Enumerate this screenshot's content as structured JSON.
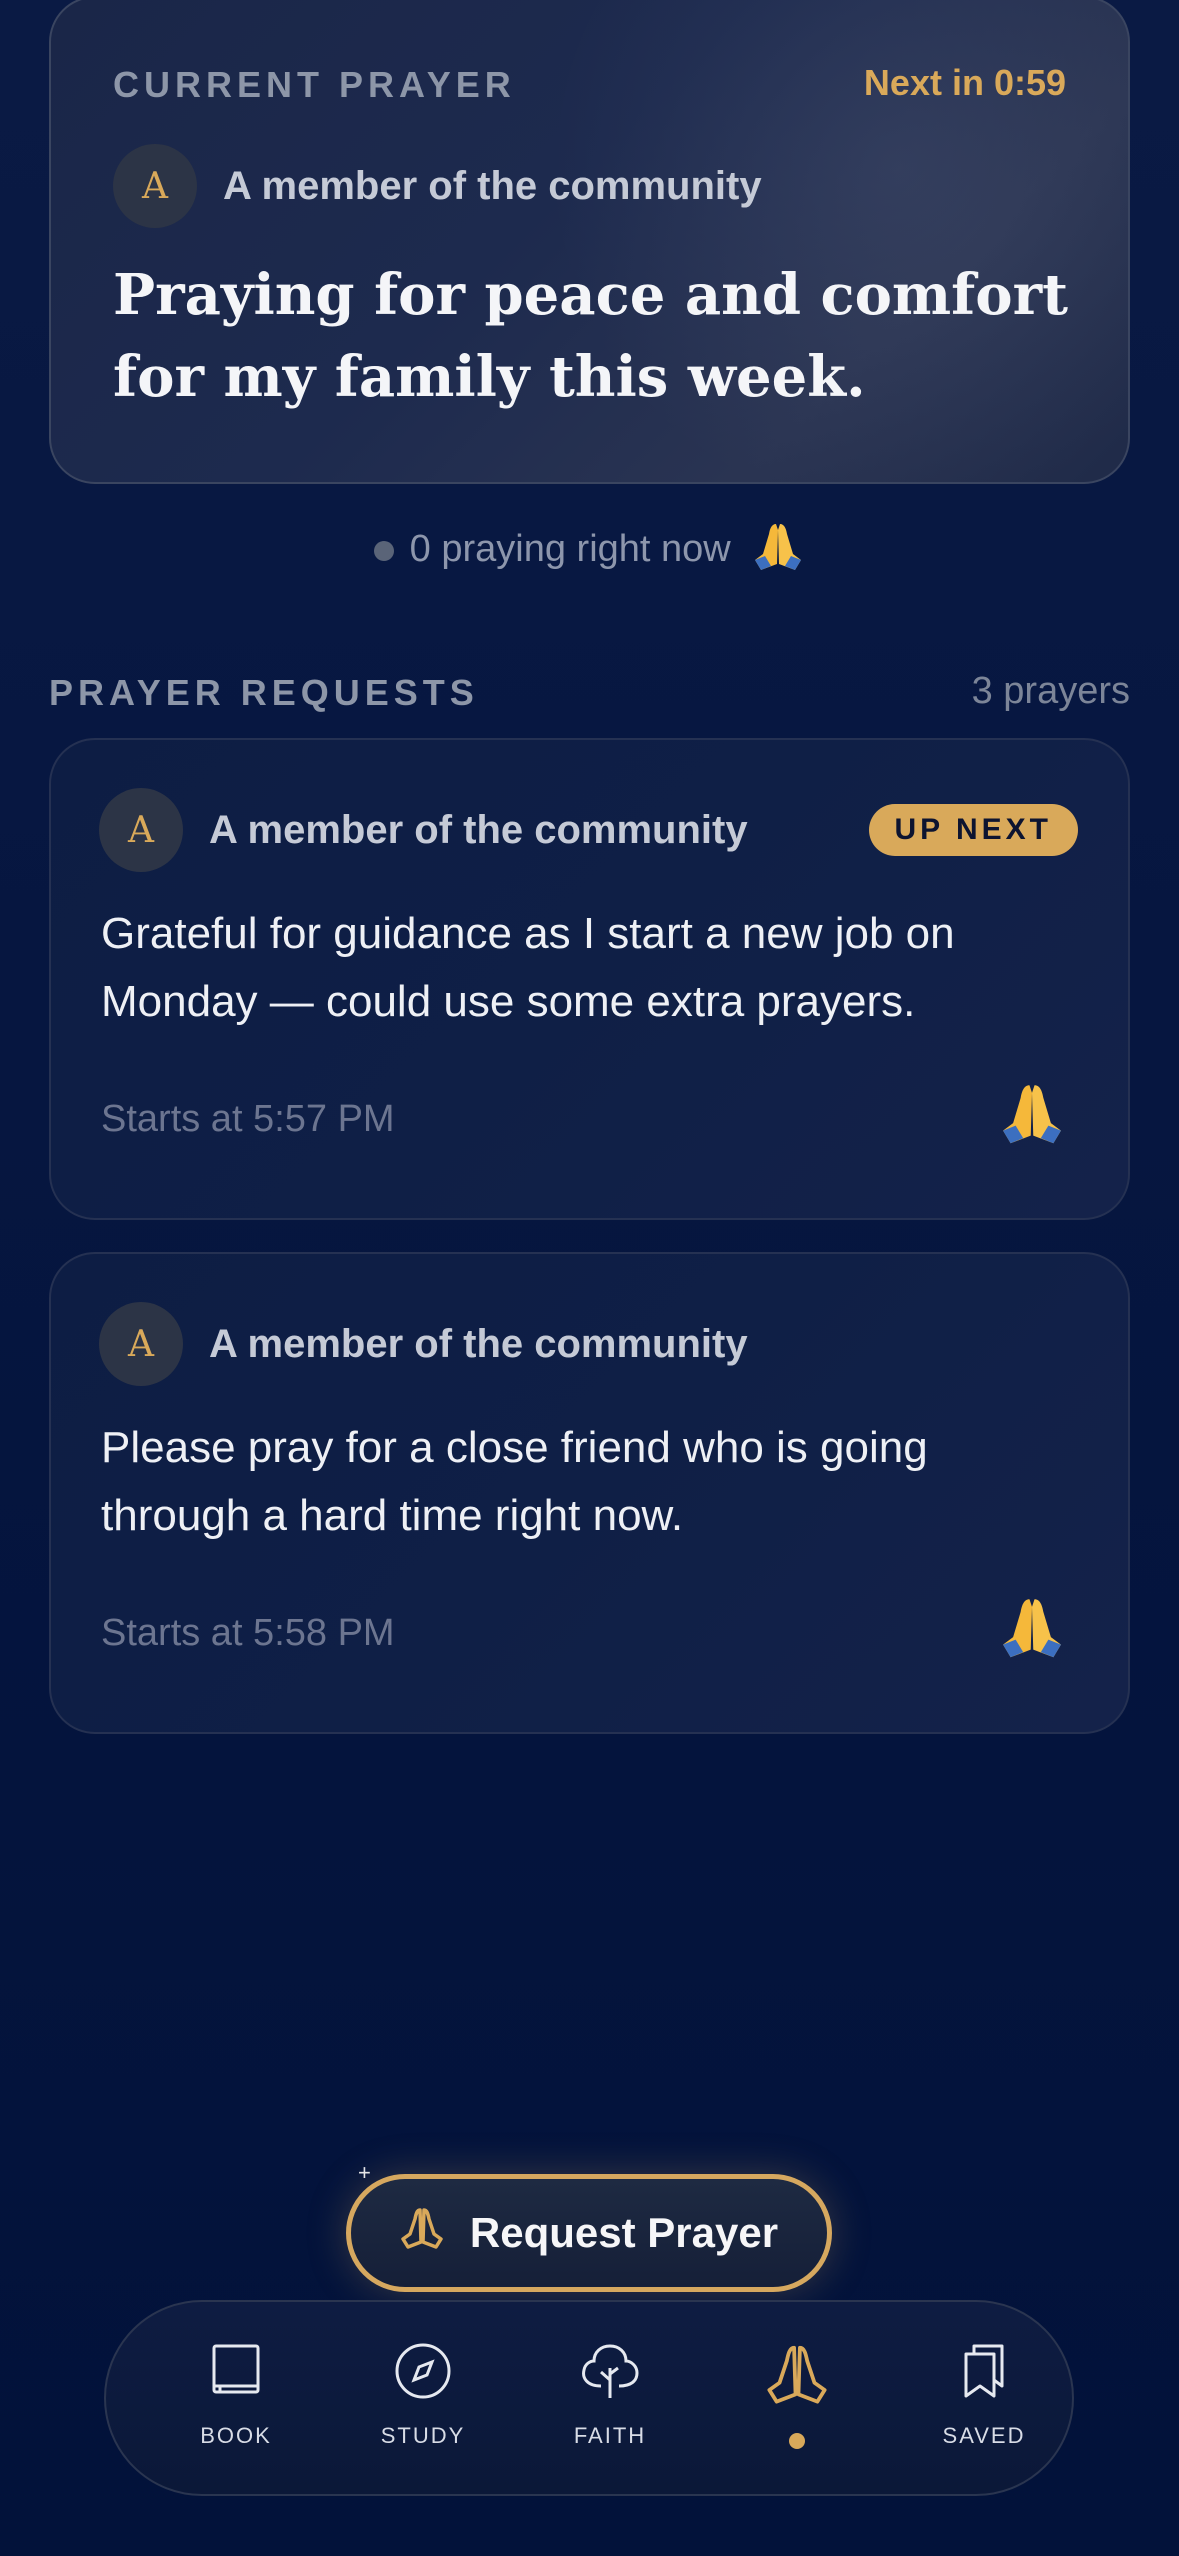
{
  "current": {
    "label": "CURRENT PRAYER",
    "next": "Next in 0:59",
    "avatar_letter": "A",
    "member": "A member of the community",
    "text": "Praying for peace and comfort for my family this week."
  },
  "praying_now": "0 praying right now",
  "requests_section": {
    "title": "PRAYER REQUESTS",
    "count": "3 prayers"
  },
  "requests": [
    {
      "avatar_letter": "A",
      "member": "A member of the community",
      "badge": "UP NEXT",
      "text": "Grateful for guidance as I start a new job on Monday — could use some extra prayers.",
      "time": "Starts at 5:57 PM"
    },
    {
      "avatar_letter": "A",
      "member": "A member of the community",
      "text": "Please pray for a close friend who is going through a hard time right now.",
      "time": "Starts at 5:58 PM"
    }
  ],
  "request_button": "Request Prayer",
  "nav": {
    "items": [
      {
        "label": "BOOK",
        "icon": "book-icon"
      },
      {
        "label": "STUDY",
        "icon": "compass-icon"
      },
      {
        "label": "FAITH",
        "icon": "tree-icon"
      },
      {
        "label": "",
        "icon": "praying-hands-icon",
        "active": true
      },
      {
        "label": "SAVED",
        "icon": "bookmarks-icon"
      }
    ]
  },
  "colors": {
    "accent": "#d9a95a",
    "background": "#03123a",
    "card": "#0f1f46"
  }
}
